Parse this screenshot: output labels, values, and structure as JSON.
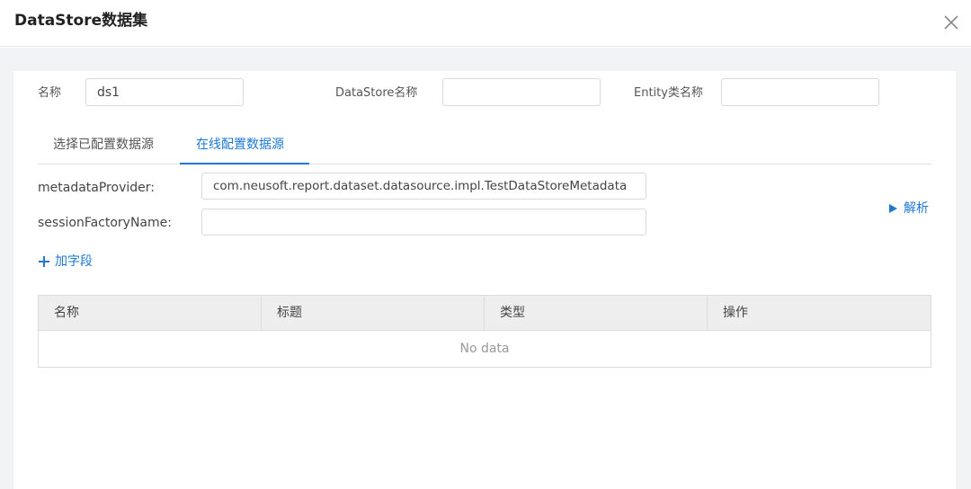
{
  "dialog": {
    "title": "DataStore数据集"
  },
  "form": {
    "name_label": "名称",
    "name_value": "ds1",
    "datastore_name_label": "DataStore名称",
    "datastore_name_value": "",
    "entity_label": "Entity类名称",
    "entity_value": ""
  },
  "tabs": [
    {
      "label": "选择已配置数据源",
      "active": false
    },
    {
      "label": "在线配置数据源",
      "active": true
    }
  ],
  "online": {
    "metadata_label": "metadataProvider:",
    "metadata_value": "com.neusoft.report.dataset.datasource.impl.TestDataStoreMetadata",
    "session_label": "sessionFactoryName:",
    "session_value": "",
    "parse_label": "解析",
    "add_field_label": "加字段"
  },
  "table": {
    "columns": [
      "名称",
      "标题",
      "类型",
      "操作"
    ],
    "empty_text": "No data"
  },
  "colors": {
    "accent": "#1e78d4",
    "backdrop": "#f2f3f5",
    "header_bg": "#eeeeee"
  },
  "icons": {
    "close": "close-icon",
    "parse": "triangle-right-icon",
    "add": "plus-icon"
  }
}
